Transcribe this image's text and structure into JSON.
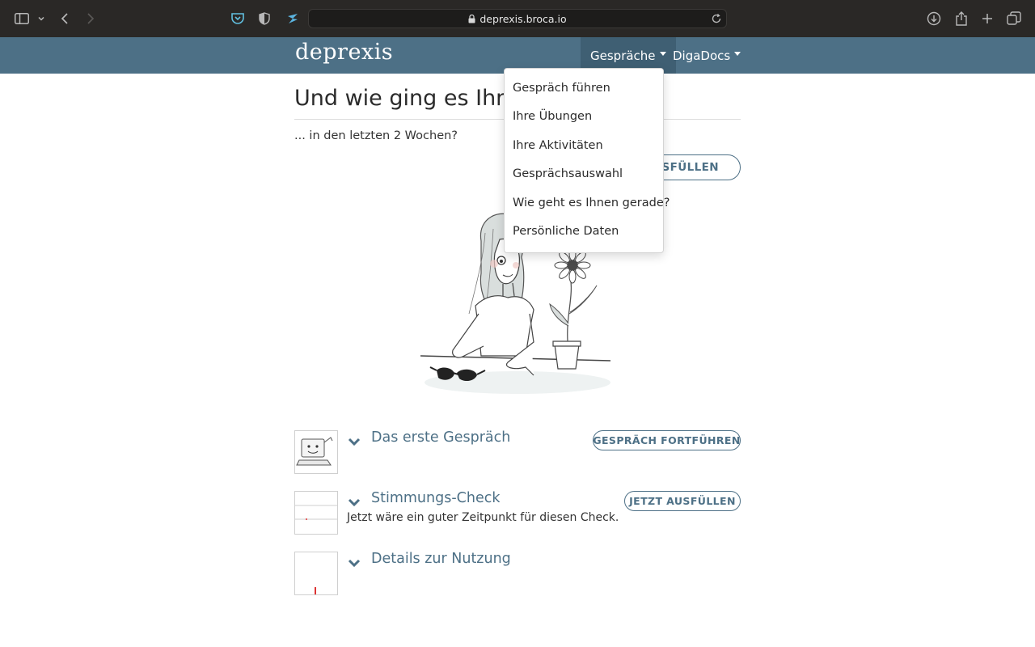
{
  "browser": {
    "url": "deprexis.broca.io"
  },
  "nav": {
    "brand": "deprexis",
    "items": [
      {
        "label": "Gespräche"
      },
      {
        "label": "DigaDocs"
      }
    ]
  },
  "dropdown": {
    "items": [
      {
        "label": "Gespräch führen"
      },
      {
        "label": "Ihre Übungen"
      },
      {
        "label": "Ihre Aktivitäten"
      },
      {
        "label": "Gesprächsauswahl"
      },
      {
        "label": "Wie geht es Ihnen gerade?"
      },
      {
        "label": "Persönliche Daten"
      }
    ]
  },
  "main": {
    "title": "Und wie ging es Ihne",
    "subtitle": "... in den letzten 2 Wochen?",
    "top_button": "AUSFÜLLEN"
  },
  "sections": [
    {
      "title": "Das erste Gespräch",
      "button": "GESPRÄCH FORTFÜHREN"
    },
    {
      "title": "Stimmungs-Check",
      "button": "JETZT AUSFÜLLEN",
      "description": "Jetzt wäre ein guter Zeitpunkt für diesen Check."
    },
    {
      "title": "Details zur Nutzung"
    }
  ],
  "colors": {
    "nav_bg": "#4d7086",
    "accent": "#4d7086",
    "chrome_bg": "#2a2826"
  },
  "icons": [
    "sidebar-icon",
    "back-icon",
    "forward-icon",
    "pocket-icon",
    "shield-icon",
    "extension-icon",
    "lock-icon",
    "reload-icon",
    "download-icon",
    "share-icon",
    "new-tab-icon",
    "tabs-overview-icon",
    "chevron-down-icon"
  ]
}
